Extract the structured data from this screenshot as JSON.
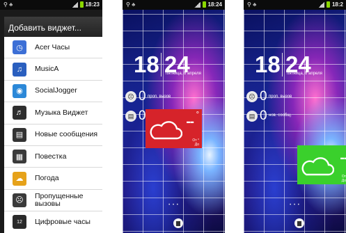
{
  "status": {
    "time1": "18:23",
    "time2": "18:24",
    "time3": "18:2"
  },
  "dialog": {
    "title": "Добавить виджет...",
    "items": [
      {
        "label": "Acer Часы",
        "icon": "acer-clock-icon",
        "color": "#3c6fd6"
      },
      {
        "label": "MusicA",
        "icon": "music-note-icon",
        "color": "#2a5fbf"
      },
      {
        "label": "SocialJogger",
        "icon": "social-jogger-icon",
        "color": "#2b88d8"
      },
      {
        "label": "Музыка Виджет",
        "icon": "music-widget-icon",
        "color": "#2e2e2e"
      },
      {
        "label": "Новые сообщения",
        "icon": "message-icon",
        "color": "#333333"
      },
      {
        "label": "Повестка",
        "icon": "calendar-icon",
        "color": "#3a3a3a"
      },
      {
        "label": "Погода",
        "icon": "weather-icon",
        "color": "#e6a21a"
      },
      {
        "label": "Пропущенные вызовы",
        "icon": "missed-call-icon",
        "color": "#3a3a3a"
      },
      {
        "label": "Цифровые часы",
        "icon": "digital-clock-icon",
        "color": "#2a2a2a"
      }
    ]
  },
  "home": {
    "hour": "18",
    "minute": "24",
    "date": "пятница, 8 апреля",
    "missed_count": "0",
    "missed_label": "проп. вызов",
    "msg_count": "0",
    "msg_label": "нов. сообщ.",
    "weather_temp": "--",
    "weather_deg": "°",
    "weather_from": "От",
    "weather_to": "До",
    "page_dots": "• • •"
  },
  "colors": {
    "weather_red": "#d6232a",
    "weather_green": "#3ad02c"
  }
}
